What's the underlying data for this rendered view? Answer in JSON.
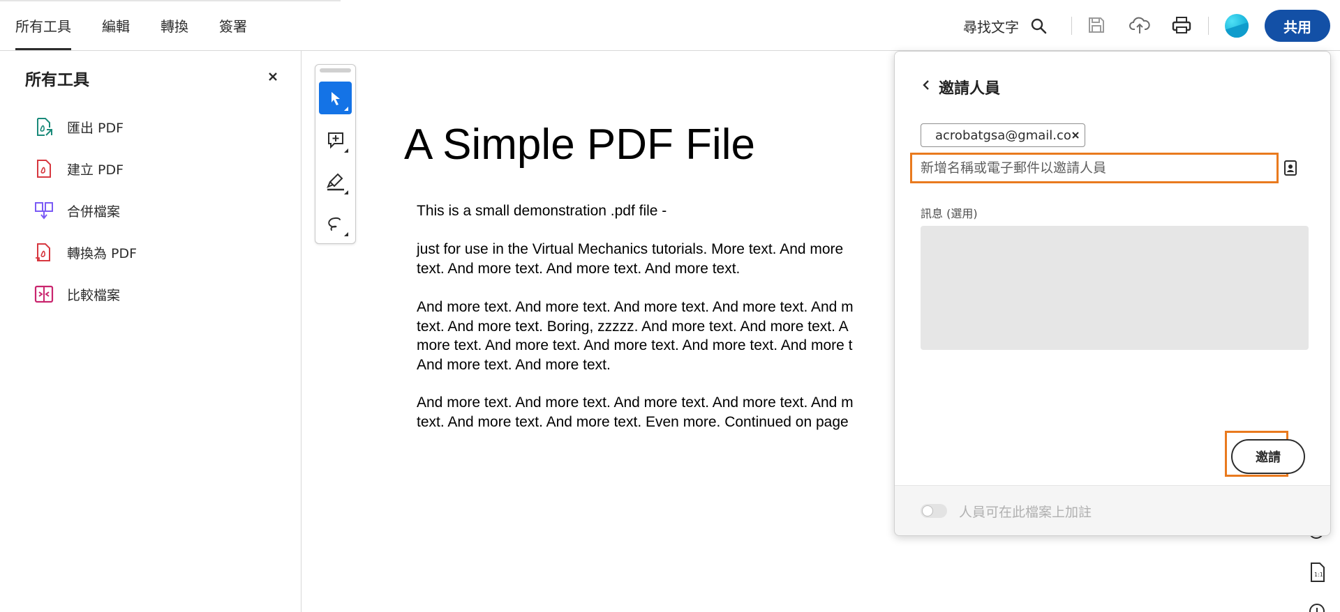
{
  "topbar": {
    "tabs": [
      "所有工具",
      "編輯",
      "轉換",
      "簽署"
    ],
    "find_text": "尋找文字",
    "share_label": "共用"
  },
  "left_panel": {
    "title": "所有工具",
    "tools": [
      {
        "label": "匯出 PDF",
        "icon": "export-pdf-icon",
        "color": "#1a8a7a"
      },
      {
        "label": "建立 PDF",
        "icon": "create-pdf-icon",
        "color": "#d7373f"
      },
      {
        "label": "合併檔案",
        "icon": "combine-files-icon",
        "color": "#7a5af5"
      },
      {
        "label": "轉換為 PDF",
        "icon": "convert-to-pdf-icon",
        "color": "#d7373f"
      },
      {
        "label": "比較檔案",
        "icon": "compare-files-icon",
        "color": "#c9256e"
      }
    ]
  },
  "document": {
    "title": "A Simple PDF File",
    "paragraphs": [
      "This is a small demonstration .pdf file -",
      "just for use in the Virtual Mechanics tutorials. More text. And more\ntext. And more text. And more text. And more text.",
      "And more text. And more text. And more text. And more text. And m\ntext. And more text. Boring, zzzzz. And more text. And more text. A\nmore text. And more text. And more text. And more text. And more t\nAnd more text. And more text.",
      "And more text. And more text. And more text. And more text. And m\ntext. And more text. And more text. Even more. Continued on page"
    ]
  },
  "invite_panel": {
    "title": "邀請人員",
    "chip_email": "acrobatgsa@gmail.co",
    "input_placeholder": "新增名稱或電子郵件以邀請人員",
    "input_value": "",
    "message_label": "訊息 (選用)",
    "invite_button": "邀請",
    "toggle_label": "人員可在此檔案上加註",
    "toggle_on": false
  },
  "colors": {
    "accent": "#1350a6",
    "selected_tool": "#1473e6",
    "highlight": "#e97a1e"
  }
}
